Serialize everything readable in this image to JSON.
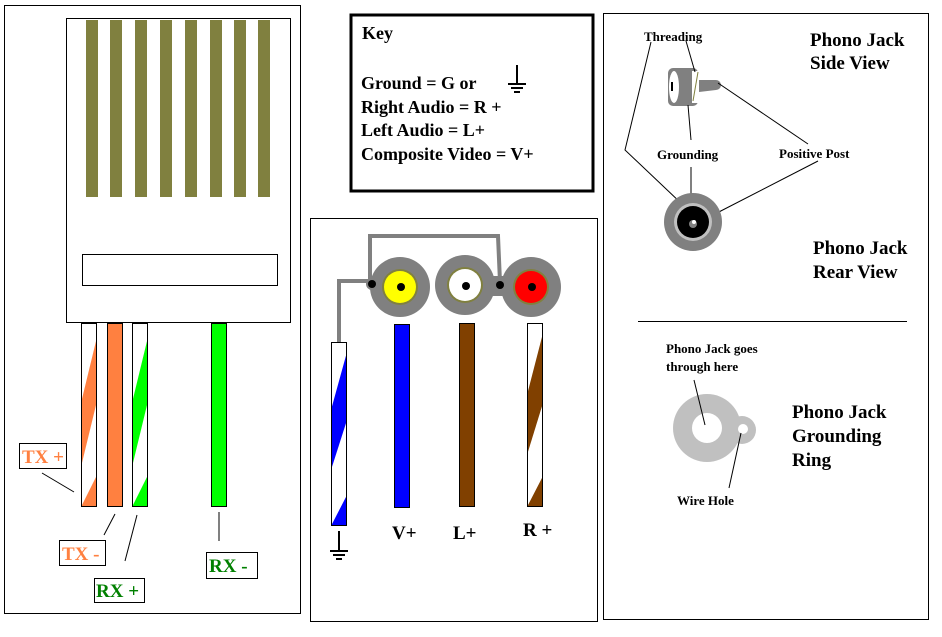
{
  "colors": {
    "olive_contacts": "#80803f",
    "orange": "#ff8040",
    "green": "#00ff00",
    "dark_green": "#008000",
    "blue": "#0000ff",
    "brown": "#804000",
    "yellow": "#ffff00",
    "red": "#ff0000",
    "gray": "#808080",
    "light_gray": "#c0c0c0"
  },
  "ethernet": {
    "labels": {
      "tx_plus": "TX +",
      "tx_minus": "TX -",
      "rx_plus": "RX +",
      "rx_minus": "RX -"
    }
  },
  "key": {
    "title": "Key",
    "lines": [
      "Ground = G or",
      "Right Audio = R +",
      "Left Audio = L+",
      "Composite Video = V+"
    ],
    "ground_icon": "ground-symbol-icon"
  },
  "rca": {
    "labels": {
      "video": "V+",
      "left": "L+",
      "right": "R +"
    },
    "ground_icon": "ground-symbol-icon"
  },
  "phono": {
    "side_view_title": [
      "Phono Jack",
      "Side View"
    ],
    "rear_view_title": [
      "Phono Jack",
      "Rear View"
    ],
    "threading": "Threading",
    "grounding": "Grounding",
    "positive_post": "Positive Post",
    "ring_title": [
      "Phono Jack",
      "Grounding",
      "Ring"
    ],
    "goes_through": [
      "Phono Jack goes",
      "through here"
    ],
    "wire_hole": "Wire Hole"
  }
}
